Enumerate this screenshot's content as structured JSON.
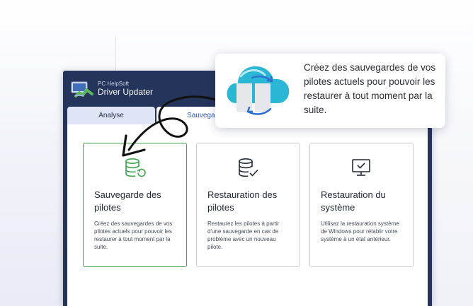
{
  "app": {
    "brand_small": "PC HelpSoft",
    "brand_large": "Driver Updater"
  },
  "tabs": [
    {
      "label": "Analyse",
      "icon": "none"
    },
    {
      "label": "Sauvegarde",
      "icon": "none"
    }
  ],
  "cards": [
    {
      "title": "Sauvegarde des pilotes",
      "description": "Créez des sauvegardes de vos pilotes actuels pour pouvoir les restaurer à tout moment par la suite.",
      "icon": "database-restore-icon",
      "selected": true
    },
    {
      "title": "Restauration des pilotes",
      "description": "Restaurez les pilotes à partir d'une sauvegarde en cas de problème avec un nouveau pilote.",
      "icon": "database-check-icon",
      "selected": false
    },
    {
      "title": "Restauration du système",
      "description": "Utilisez la restauration système de Windows pour rétablir votre système à un état antérieur.",
      "icon": "monitor-check-icon",
      "selected": false
    }
  ],
  "tooltip": {
    "text": "Créez des sauvegardes de vos pilotes actuels pour pouvoir les restaurer à tout moment par la suite.",
    "icon": "cloud-sync-icon"
  },
  "colors": {
    "window": "#24345a",
    "selected_border": "#3fa34d",
    "accent_green": "#3fa34d",
    "cloud_teal": "#2ab7d6",
    "sync_blue": "#2f6fd0"
  }
}
